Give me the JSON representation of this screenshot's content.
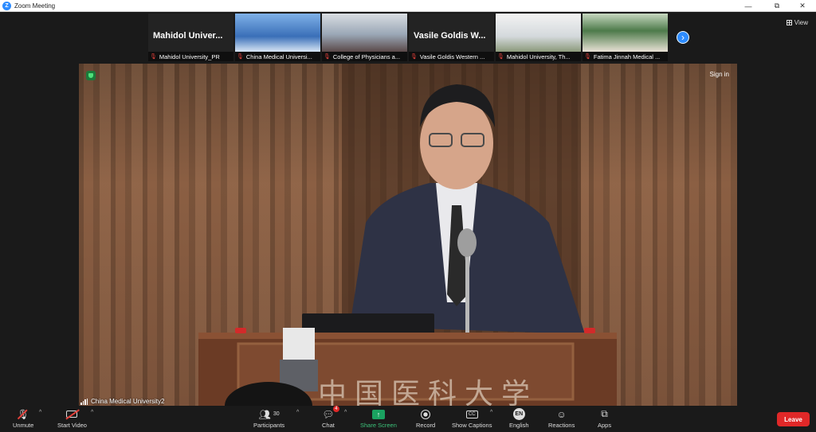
{
  "window": {
    "title": "Zoom Meeting",
    "controls": [
      "—",
      "⧉",
      "✕"
    ]
  },
  "view_button": {
    "label": "View"
  },
  "thumbnails": [
    {
      "big_name": "Mahidol Univer...",
      "label": "Mahidol University_PR",
      "muted": true,
      "type": "name"
    },
    {
      "big_name": "",
      "label": "China Medical Universi...",
      "muted": true,
      "type": "video",
      "colors": [
        "#3a6fb8",
        "#7fb1e8"
      ]
    },
    {
      "big_name": "",
      "label": "College of Physicians a...",
      "muted": true,
      "type": "video",
      "colors": [
        "#9aa7b6",
        "#d9dde2"
      ]
    },
    {
      "big_name": "Vasile Goldis W...",
      "label": "Vasile Goldis Western ...",
      "muted": true,
      "type": "name"
    },
    {
      "big_name": "",
      "label": "Mahidol University, Th...",
      "muted": true,
      "type": "video",
      "colors": [
        "#d4d9dc",
        "#f3f3f3"
      ]
    },
    {
      "big_name": "",
      "label": "Fatima Jinnah Medical ...",
      "muted": true,
      "type": "video",
      "colors": [
        "#4d7a4a",
        "#c7d8c0"
      ]
    }
  ],
  "main": {
    "speaker": "China Medical University2",
    "sign_in": "Sign in",
    "podium_text": "中国医科大学"
  },
  "toolbar": {
    "unmute": "Unmute",
    "start_video": "Start Video",
    "participants": "Participants",
    "participants_count": "30",
    "chat": "Chat",
    "chat_badge": "4",
    "share_screen": "Share Screen",
    "record": "Record",
    "show_captions": "Show Captions",
    "english": "English",
    "english_icon": "EN",
    "reactions": "Reactions",
    "apps": "Apps",
    "leave": "Leave"
  },
  "colors": {
    "accent": "#2d8cff",
    "leave": "#e02828",
    "share": "#1aa260",
    "mic_muted": "#e2403a"
  }
}
